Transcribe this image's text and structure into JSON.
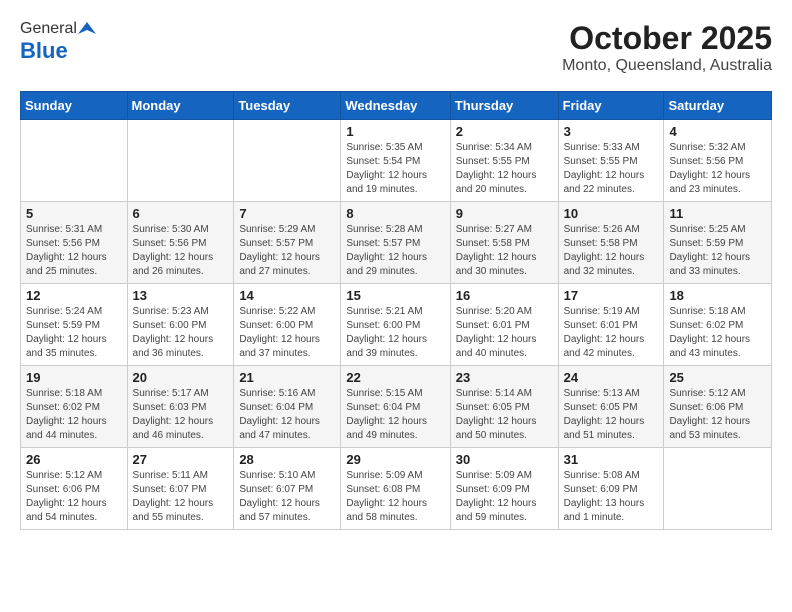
{
  "header": {
    "logo_general": "General",
    "logo_blue": "Blue",
    "title": "October 2025",
    "subtitle": "Monto, Queensland, Australia"
  },
  "days_of_week": [
    "Sunday",
    "Monday",
    "Tuesday",
    "Wednesday",
    "Thursday",
    "Friday",
    "Saturday"
  ],
  "weeks": [
    [
      {
        "day": "",
        "info": ""
      },
      {
        "day": "",
        "info": ""
      },
      {
        "day": "",
        "info": ""
      },
      {
        "day": "1",
        "info": "Sunrise: 5:35 AM\nSunset: 5:54 PM\nDaylight: 12 hours and 19 minutes."
      },
      {
        "day": "2",
        "info": "Sunrise: 5:34 AM\nSunset: 5:55 PM\nDaylight: 12 hours and 20 minutes."
      },
      {
        "day": "3",
        "info": "Sunrise: 5:33 AM\nSunset: 5:55 PM\nDaylight: 12 hours and 22 minutes."
      },
      {
        "day": "4",
        "info": "Sunrise: 5:32 AM\nSunset: 5:56 PM\nDaylight: 12 hours and 23 minutes."
      }
    ],
    [
      {
        "day": "5",
        "info": "Sunrise: 5:31 AM\nSunset: 5:56 PM\nDaylight: 12 hours and 25 minutes."
      },
      {
        "day": "6",
        "info": "Sunrise: 5:30 AM\nSunset: 5:56 PM\nDaylight: 12 hours and 26 minutes."
      },
      {
        "day": "7",
        "info": "Sunrise: 5:29 AM\nSunset: 5:57 PM\nDaylight: 12 hours and 27 minutes."
      },
      {
        "day": "8",
        "info": "Sunrise: 5:28 AM\nSunset: 5:57 PM\nDaylight: 12 hours and 29 minutes."
      },
      {
        "day": "9",
        "info": "Sunrise: 5:27 AM\nSunset: 5:58 PM\nDaylight: 12 hours and 30 minutes."
      },
      {
        "day": "10",
        "info": "Sunrise: 5:26 AM\nSunset: 5:58 PM\nDaylight: 12 hours and 32 minutes."
      },
      {
        "day": "11",
        "info": "Sunrise: 5:25 AM\nSunset: 5:59 PM\nDaylight: 12 hours and 33 minutes."
      }
    ],
    [
      {
        "day": "12",
        "info": "Sunrise: 5:24 AM\nSunset: 5:59 PM\nDaylight: 12 hours and 35 minutes."
      },
      {
        "day": "13",
        "info": "Sunrise: 5:23 AM\nSunset: 6:00 PM\nDaylight: 12 hours and 36 minutes."
      },
      {
        "day": "14",
        "info": "Sunrise: 5:22 AM\nSunset: 6:00 PM\nDaylight: 12 hours and 37 minutes."
      },
      {
        "day": "15",
        "info": "Sunrise: 5:21 AM\nSunset: 6:00 PM\nDaylight: 12 hours and 39 minutes."
      },
      {
        "day": "16",
        "info": "Sunrise: 5:20 AM\nSunset: 6:01 PM\nDaylight: 12 hours and 40 minutes."
      },
      {
        "day": "17",
        "info": "Sunrise: 5:19 AM\nSunset: 6:01 PM\nDaylight: 12 hours and 42 minutes."
      },
      {
        "day": "18",
        "info": "Sunrise: 5:18 AM\nSunset: 6:02 PM\nDaylight: 12 hours and 43 minutes."
      }
    ],
    [
      {
        "day": "19",
        "info": "Sunrise: 5:18 AM\nSunset: 6:02 PM\nDaylight: 12 hours and 44 minutes."
      },
      {
        "day": "20",
        "info": "Sunrise: 5:17 AM\nSunset: 6:03 PM\nDaylight: 12 hours and 46 minutes."
      },
      {
        "day": "21",
        "info": "Sunrise: 5:16 AM\nSunset: 6:04 PM\nDaylight: 12 hours and 47 minutes."
      },
      {
        "day": "22",
        "info": "Sunrise: 5:15 AM\nSunset: 6:04 PM\nDaylight: 12 hours and 49 minutes."
      },
      {
        "day": "23",
        "info": "Sunrise: 5:14 AM\nSunset: 6:05 PM\nDaylight: 12 hours and 50 minutes."
      },
      {
        "day": "24",
        "info": "Sunrise: 5:13 AM\nSunset: 6:05 PM\nDaylight: 12 hours and 51 minutes."
      },
      {
        "day": "25",
        "info": "Sunrise: 5:12 AM\nSunset: 6:06 PM\nDaylight: 12 hours and 53 minutes."
      }
    ],
    [
      {
        "day": "26",
        "info": "Sunrise: 5:12 AM\nSunset: 6:06 PM\nDaylight: 12 hours and 54 minutes."
      },
      {
        "day": "27",
        "info": "Sunrise: 5:11 AM\nSunset: 6:07 PM\nDaylight: 12 hours and 55 minutes."
      },
      {
        "day": "28",
        "info": "Sunrise: 5:10 AM\nSunset: 6:07 PM\nDaylight: 12 hours and 57 minutes."
      },
      {
        "day": "29",
        "info": "Sunrise: 5:09 AM\nSunset: 6:08 PM\nDaylight: 12 hours and 58 minutes."
      },
      {
        "day": "30",
        "info": "Sunrise: 5:09 AM\nSunset: 6:09 PM\nDaylight: 12 hours and 59 minutes."
      },
      {
        "day": "31",
        "info": "Sunrise: 5:08 AM\nSunset: 6:09 PM\nDaylight: 13 hours and 1 minute."
      },
      {
        "day": "",
        "info": ""
      }
    ]
  ]
}
